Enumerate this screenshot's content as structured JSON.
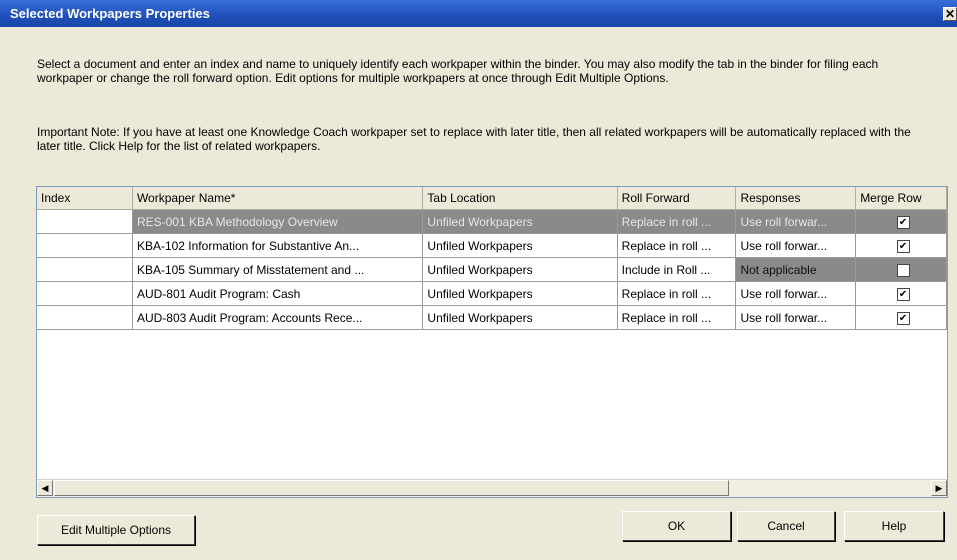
{
  "window": {
    "title": "Selected Workpapers Properties",
    "close_glyph": "✕"
  },
  "instructions": {
    "para1": "Select a document and enter an index and name to uniquely identify each workpaper within the binder.  You may also modify the tab in the binder for filing each workpaper or change the roll forward option. Edit options for multiple workpapers at once through Edit Multiple Options.",
    "para2": "Important Note: If you have at least one Knowledge Coach workpaper set to replace with later title, then all related workpapers will be automatically replaced with the later title. Click Help for the list of related workpapers."
  },
  "grid": {
    "columns": [
      "Index",
      "Workpaper Name*",
      "Tab Location",
      "Roll Forward",
      "Responses",
      "Merge Row"
    ],
    "rows": [
      {
        "index": "",
        "name": "RES-001 KBA Methodology Overview",
        "tab": "Unfiled Workpapers",
        "roll": "Replace in roll ...",
        "responses": "Use roll forwar...",
        "merge": true,
        "selected": true
      },
      {
        "index": "",
        "name": "KBA-102 Information for Substantive An...",
        "tab": "Unfiled Workpapers",
        "roll": "Replace in roll ...",
        "responses": "Use roll forwar...",
        "merge": true,
        "selected": false
      },
      {
        "index": "",
        "name": "KBA-105 Summary of Misstatement and ...",
        "tab": "Unfiled Workpapers",
        "roll": "Include in Roll ...",
        "responses": "Not applicable",
        "merge": false,
        "selected": false
      },
      {
        "index": "",
        "name": "AUD-801 Audit Program: Cash",
        "tab": "Unfiled Workpapers",
        "roll": "Replace in roll ...",
        "responses": "Use roll forwar...",
        "merge": true,
        "selected": false
      },
      {
        "index": "",
        "name": "AUD-803 Audit Program: Accounts Rece...",
        "tab": "Unfiled Workpapers",
        "roll": "Replace in roll ...",
        "responses": "Use roll forwar...",
        "merge": true,
        "selected": false
      }
    ]
  },
  "buttons": {
    "edit_multiple": "Edit Multiple Options",
    "ok": "OK",
    "cancel": "Cancel",
    "help": "Help"
  },
  "icons": {
    "scroll_left": "◀",
    "scroll_right": "▶",
    "check": "✔"
  },
  "colors": {
    "title_bar": "#1f4fb8",
    "dialog_bg": "#ece9d8",
    "selected_row": "#8a8a8a"
  }
}
